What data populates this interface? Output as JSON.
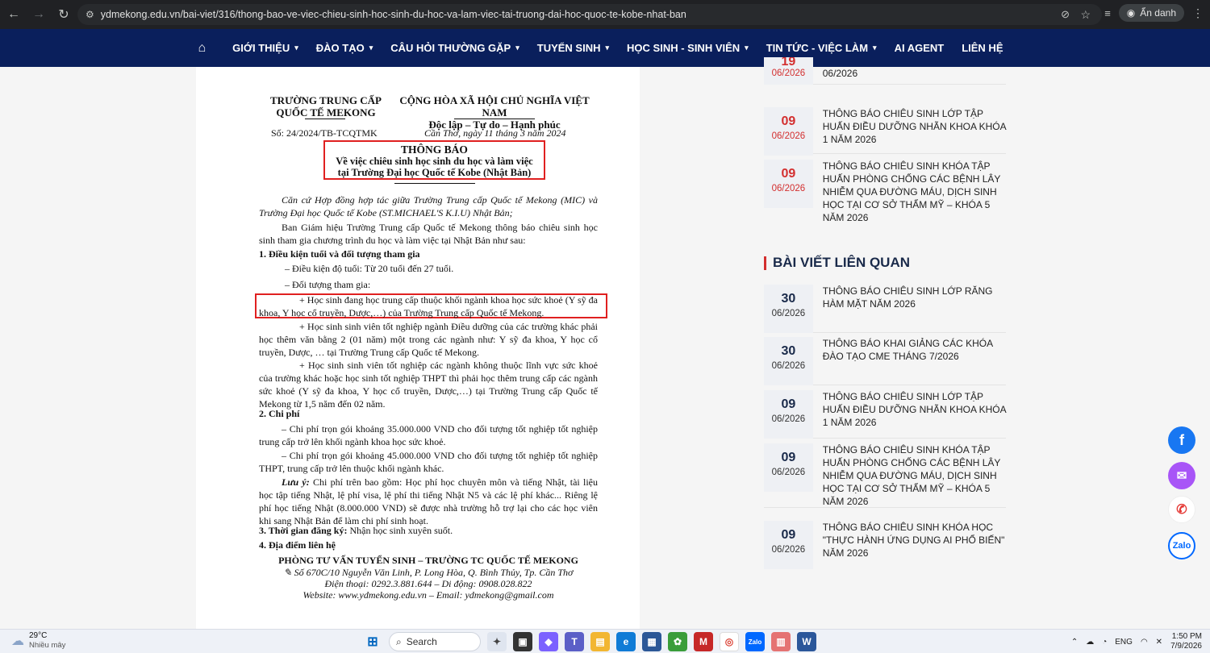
{
  "browser": {
    "url": "ydmekong.edu.vn/bai-viet/316/thong-bao-ve-viec-chieu-sinh-hoc-sinh-du-hoc-va-lam-viec-tai-truong-dai-hoc-quoc-te-kobe-nhat-ban",
    "incognito_label": "Ẩn danh"
  },
  "nav": {
    "items": [
      "GIỚI THIỆU",
      "ĐÀO TẠO",
      "CÂU HỎI THƯỜNG GẶP",
      "TUYỂN SINH",
      "HỌC SINH - SINH VIÊN",
      "TIN TỨC - VIỆC LÀM",
      "AI AGENT",
      "LIÊN HỆ"
    ]
  },
  "document": {
    "left_header": [
      "TRƯỜNG TRUNG CẤP",
      "QUỐC TẾ MEKONG"
    ],
    "right_header": [
      "CỘNG HÒA XÃ HỘI CHỦ NGHĨA VIỆT NAM",
      "Độc lập – Tự do – Hạnh phúc"
    ],
    "number": "Số: 24/2024/TB-TCQTMK",
    "date": "Cần Thơ, ngày 11 tháng 3 năm 2024",
    "title": "THÔNG BÁO",
    "subtitle": [
      "Về việc chiêu sinh học sinh du học và làm việc",
      "tại Trường Đại học Quốc tế Kobe (Nhật Bản)"
    ],
    "p1": "Căn cứ Hợp đồng hợp tác giữa Trường Trung cấp Quốc tế Mekong (MIC) và Trường Đại học Quốc tế Kobe (ST.MICHAEL'S K.I.U) Nhật Bản;",
    "p2": "Ban Giám hiệu Trường Trung cấp Quốc tế Mekong thông báo chiêu sinh học sinh tham gia chương trình du học và làm việc tại Nhật Bản như sau:",
    "h1": "1. Điều kiện tuổi và đối tượng tham gia",
    "age": "–  Điều kiện độ tuổi: Từ 20 tuổi đến 27 tuổi.",
    "target": "–  Đối tượng tham gia:",
    "t1": "+ Học sinh đang học trung cấp thuộc khối ngành khoa học sức khoẻ (Y sỹ đa khoa, Y học cổ truyền, Dược,…) của Trường Trung cấp Quốc tế Mekong.",
    "t2": "+ Học sinh sinh viên tốt nghiệp ngành Điều dưỡng của các trường khác phải học thêm văn bằng 2 (01 năm) một trong các ngành như: Y sỹ đa khoa, Y học cổ truyền, Dược, … tại Trường Trung cấp Quốc tế Mekong.",
    "t3": "+ Học sinh sinh viên tốt nghiệp các ngành không thuộc lĩnh vực sức khoẻ của trường khác hoặc học sinh tốt nghiệp THPT thì phải học thêm trung cấp các ngành sức khoẻ (Y sỹ đa khoa, Y học cổ truyền, Dược,…) tại Trường Trung cấp Quốc tế Mekong từ 1,5 năm đến 02 năm.",
    "h2": "2. Chi phí",
    "c1": "–  Chi phí trọn gói khoảng 35.000.000 VND cho đối tượng tốt nghiệp tốt nghiệp trung cấp trở lên khối ngành khoa học sức khoẻ.",
    "c2": "–  Chi phí trọn gói khoảng 45.000.000 VND cho đối tượng tốt nghiệp tốt nghiệp THPT, trung cấp trở lên thuộc khối ngành khác.",
    "note_label": "Lưu ý:",
    "note": " Chi phí trên bao gồm: Học phí học chuyên môn và tiếng Nhật, tài liệu học tập tiếng Nhật, lệ phí visa, lệ phí thi tiếng Nhật N5 và các lệ phí khác... Riêng lệ phí học tiếng Nhật (8.000.000 VND) sẽ được nhà trường hỗ trợ lại cho các học viên khi sang Nhật Bản để làm chi phí sinh hoạt.",
    "h3": "3. Thời gian đăng ký:",
    "h3_text": " Nhận học sinh xuyên suốt.",
    "h4": "4. Địa điểm liên hệ",
    "contact_title": "PHÒNG TƯ VẤN TUYỂN SINH – TRƯỜNG TC QUỐC TẾ MEKONG",
    "contact_addr": "✎ Số 670C/10 Nguyễn Văn Linh, P. Long Hòa, Q. Bình Thủy, Tp. Cần Thơ",
    "contact_phone": "Điện thoại: 0292.3.881.644 – Di động: 0908.028.822",
    "contact_web": "Website: www.ydmekong.edu.vn – Email: ydmekong@gmail.com"
  },
  "sidebar": {
    "top_posts": [
      {
        "day": "19",
        "month": "06/2026",
        "title": "06/2026"
      },
      {
        "day": "09",
        "month": "06/2026",
        "title": "THÔNG BÁO CHIÊU SINH LỚP TẬP HUẤN ĐIỀU DƯỠNG NHÃN KHOA KHÓA 1 NĂM 2026"
      },
      {
        "day": "09",
        "month": "06/2026",
        "title": "THÔNG BÁO CHIÊU SINH KHÓA TẬP HUẤN PHÒNG CHỐNG CÁC BỆNH LÂY NHIỄM QUA ĐƯỜNG MÁU, DỊCH SINH HỌC TẠI CƠ SỞ THẨM MỸ – KHÓA 5 NĂM 2026"
      }
    ],
    "related_title": "BÀI VIẾT LIÊN QUAN",
    "related_posts": [
      {
        "day": "30",
        "month": "06/2026",
        "title": "THÔNG BÁO CHIÊU SINH LỚP RĂNG HÀM MẶT NĂM 2026"
      },
      {
        "day": "30",
        "month": "06/2026",
        "title": "THÔNG BÁO KHAI GIẢNG CÁC KHÓA ĐÀO TẠO CME THÁNG 7/2026"
      },
      {
        "day": "09",
        "month": "06/2026",
        "title": "THÔNG BÁO CHIÊU SINH LỚP TẬP HUẤN ĐIỀU DƯỠNG NHÃN KHOA KHÓA 1 NĂM 2026"
      },
      {
        "day": "09",
        "month": "06/2026",
        "title": "THÔNG BÁO CHIÊU SINH KHÓA TẬP HUẤN PHÒNG CHỐNG CÁC BỆNH LÂY NHIỄM QUA ĐƯỜNG MÁU, DỊCH SINH HỌC TẠI CƠ SỞ THẨM MỸ – KHÓA 5 NĂM 2026"
      },
      {
        "day": "09",
        "month": "06/2026",
        "title": "THÔNG BÁO CHIÊU SINH KHÓA HỌC \"THỰC HÀNH ỨNG DỤNG AI PHỔ BIẾN\" NĂM 2026"
      }
    ]
  },
  "floating": {
    "zalo": "Zalo"
  },
  "taskbar": {
    "temp": "29°C",
    "weather": "Nhiều mây",
    "search": "Search",
    "lang": "ENG",
    "time": "1:50 PM",
    "date": "7/9/2026"
  },
  "colors": {
    "nav_bg": "#0a1f5c",
    "accent_red": "#d32f2f",
    "doc_highlight": "#e02020"
  }
}
